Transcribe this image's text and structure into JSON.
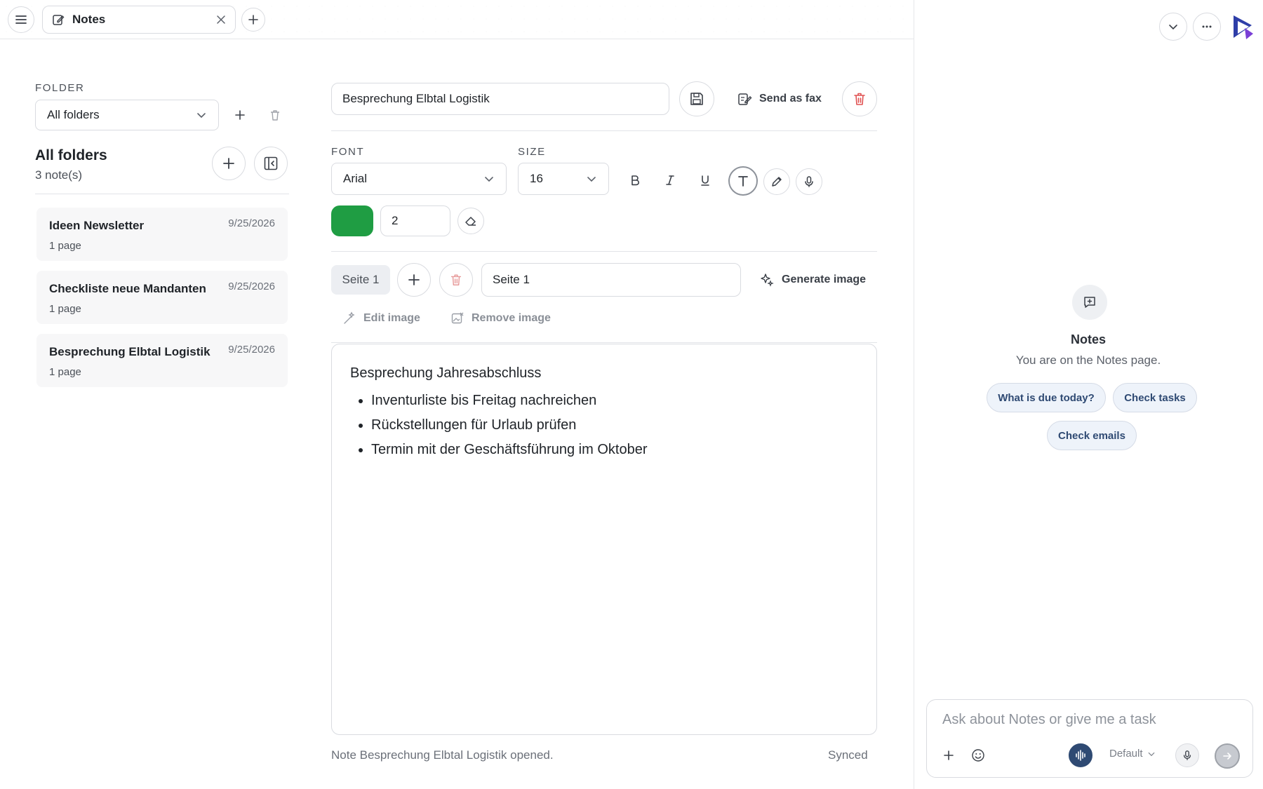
{
  "tab": {
    "title": "Notes"
  },
  "sidebar": {
    "folder_label": "FOLDER",
    "folder_select": "All folders",
    "heading": "All folders",
    "count": "3 note(s)",
    "notes": [
      {
        "title": "Ideen Newsletter",
        "date": "9/25/2026",
        "pages": "1 page"
      },
      {
        "title": "Checkliste neue Mandanten",
        "date": "9/25/2026",
        "pages": "1 page"
      },
      {
        "title": "Besprechung Elbtal Logistik",
        "date": "9/25/2026",
        "pages": "1 page"
      }
    ]
  },
  "editor_header": {
    "title_value": "Besprechung Elbtal Logistik",
    "send_fax_label": "Send as fax"
  },
  "toolbar": {
    "font_label": "FONT",
    "font_value": "Arial",
    "size_label": "SIZE",
    "size_value": "16",
    "pen_width": "2",
    "pen_color": "#1f9d43"
  },
  "pages": {
    "current_chip": "Seite 1",
    "page_name_value": "Seite 1",
    "generate_image_label": "Generate image",
    "edit_image_label": "Edit image",
    "remove_image_label": "Remove image"
  },
  "content": {
    "heading": "Besprechung Jahresabschluss",
    "bullets": [
      "Inventurliste bis Freitag nachreichen",
      "Rückstellungen für Urlaub prüfen",
      "Termin mit der Geschäftsführung im Oktober"
    ]
  },
  "status": {
    "message": "Note Besprechung Elbtal Logistik opened.",
    "sync": "Synced"
  },
  "assistant": {
    "title": "Notes",
    "subtitle": "You are on the Notes page.",
    "suggestions": [
      "What is due today?",
      "Check tasks",
      "Check emails"
    ],
    "input_placeholder": "Ask about Notes or give me a task",
    "mode": "Default"
  },
  "colors": {
    "danger": "#e05252",
    "accent_voice": "#2f4a73"
  }
}
